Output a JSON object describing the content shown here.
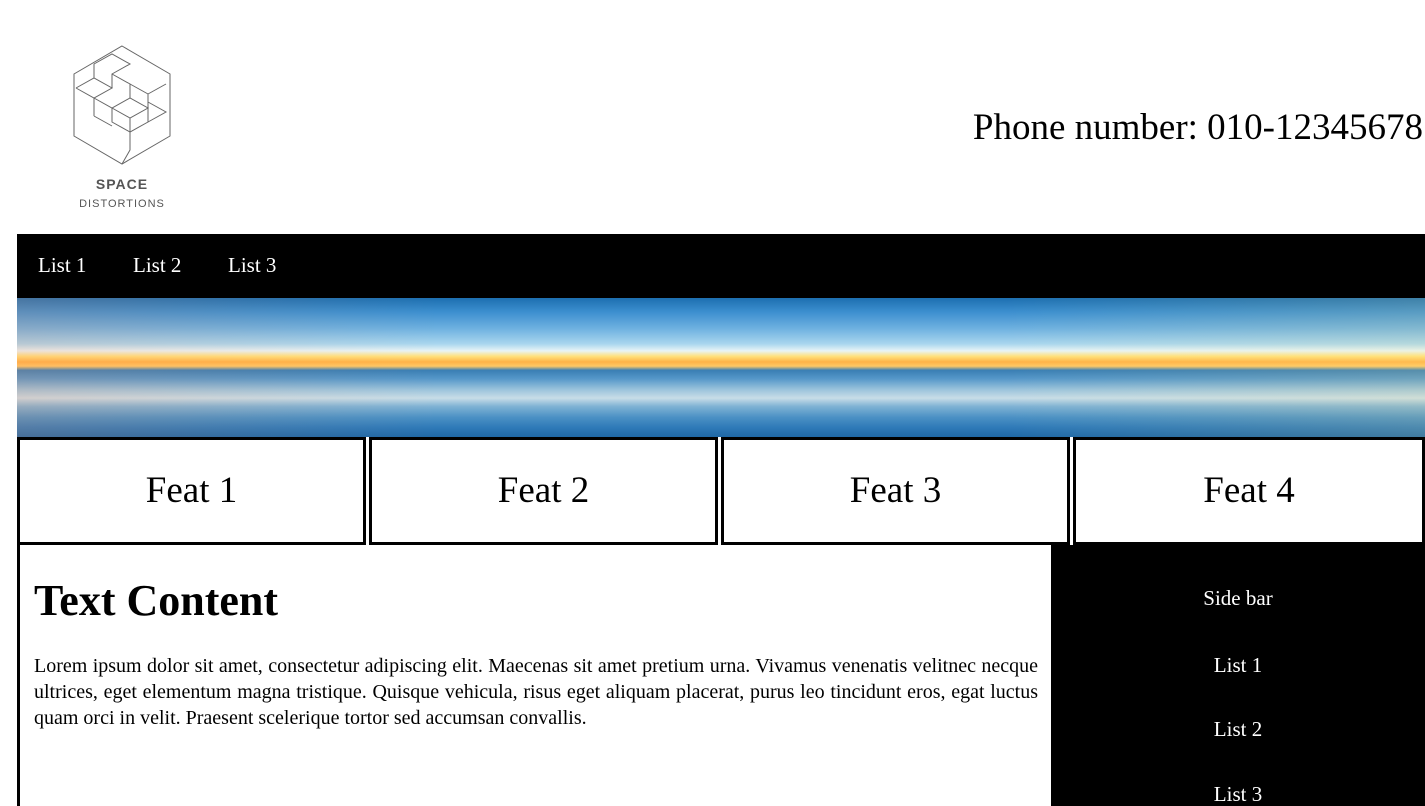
{
  "header": {
    "logo": {
      "name": "SPACE",
      "tagline": "DISTORTIONS",
      "icon": "isometric-cube-stairs-icon"
    },
    "phone": "Phone number: 010-12345678"
  },
  "nav": {
    "items": [
      "List 1",
      "List 2",
      "List 3"
    ]
  },
  "banner": {
    "image": "sky-horizon-sunset-image"
  },
  "features": {
    "items": [
      "Feat 1",
      "Feat 2",
      "Feat 3",
      "Feat 4"
    ]
  },
  "content": {
    "title": "Text Content",
    "body": "Lorem ipsum dolor sit amet, consectetur adipiscing elit. Maecenas sit amet pretium urna. Vivamus venenatis velitnec necque ultrices, eget elementum magna tristique. Quisque vehicula, risus eget aliquam placerat, purus leo tincidunt eros, egat luctus quam orci in velit. Praesent scelerique tortor sed accumsan convallis."
  },
  "sidebar": {
    "title": "Side bar",
    "items": [
      "List 1",
      "List 2",
      "List 3"
    ]
  },
  "colors": {
    "nav_bg": "#000000",
    "nav_text": "#ffffff",
    "page_bg": "#ffffff",
    "logo_text": "#555555"
  }
}
